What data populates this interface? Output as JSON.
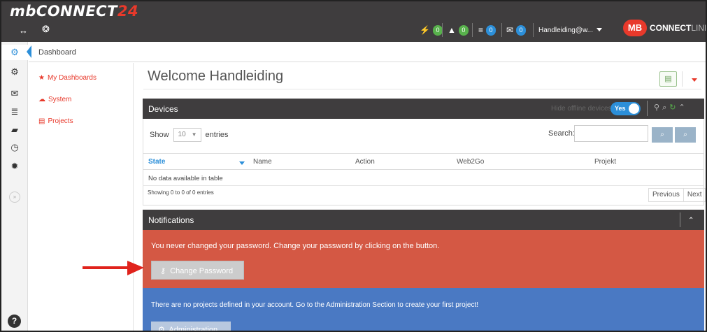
{
  "app": {
    "logo_main": "mbCONNECT",
    "logo_num": "24",
    "brand_mb": "MB",
    "brand_connect": "CONNECT",
    "brand_line": "LINE"
  },
  "topbar": {
    "stats": [
      {
        "icon": "bolt-icon",
        "glyph": "⚡",
        "count": "0",
        "color": "#58b14c"
      },
      {
        "icon": "warning-icon",
        "glyph": "▲",
        "count": "0",
        "color": "#58b14c"
      },
      {
        "icon": "list-icon",
        "glyph": "≡",
        "count": "0",
        "color": "#2c8fd9"
      },
      {
        "icon": "mail-icon",
        "glyph": "✉",
        "count": "0",
        "color": "#2c8fd9"
      }
    ],
    "user": "Handleiding@w..."
  },
  "rail_icons": [
    "dashboard-icon",
    "devices-icon",
    "mail-icon",
    "list-icon",
    "book-icon",
    "clock-icon",
    "settings-icon"
  ],
  "breadcrumb": "Dashboard",
  "subnav": {
    "items": [
      {
        "label": "My Dashboards",
        "icon": "star-icon"
      },
      {
        "label": "System",
        "icon": "cloud-icon"
      },
      {
        "label": "Projects",
        "icon": "file-icon"
      }
    ]
  },
  "main": {
    "welcome": "Welcome Handleiding"
  },
  "devices": {
    "title": "Devices",
    "hide_offline_label": "Hide offline devices",
    "toggle_value": "Yes",
    "show_label": "Show",
    "entries_value": "10",
    "entries_label": "entries",
    "search_label": "Search:",
    "columns": [
      "State",
      "Name",
      "Action",
      "Web2Go",
      "Projekt"
    ],
    "empty_message": "No data available in table",
    "showing": "Showing 0 to 0 of 0 entries",
    "previous": "Previous",
    "next": "Next"
  },
  "notifications": {
    "title": "Notifications",
    "password_message": "You never changed your password. Change your password by clicking on the button.",
    "change_password_label": "Change Password",
    "projects_message": "There are no projects defined in your account. Go to the Administration Section to create your first project!",
    "administration_label": "Administration"
  },
  "colors": {
    "topbar": "#3f3d3e",
    "accent_red": "#e8392b",
    "alert_red": "#d45844",
    "info_blue": "#4a79c3",
    "toggle_blue": "#2c8fd9",
    "badge_green": "#58b14c"
  }
}
